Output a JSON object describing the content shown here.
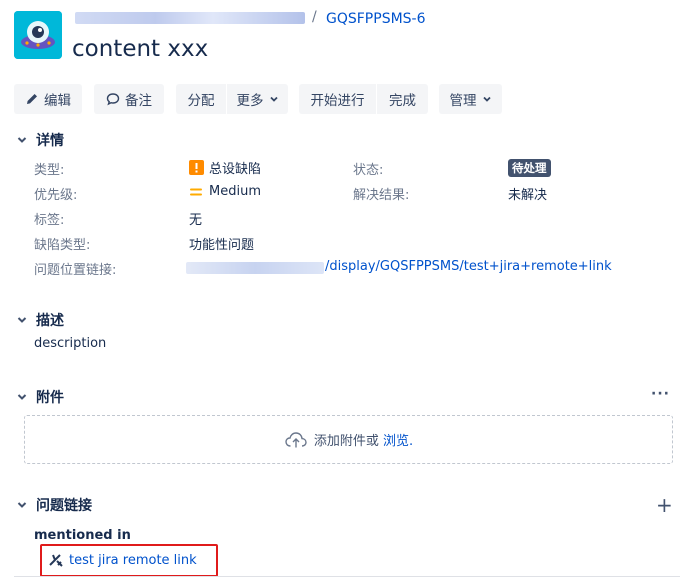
{
  "header": {
    "issue_key": "GQSFPPSMS-6",
    "separator": "/",
    "title": "content xxx"
  },
  "toolbar": {
    "edit_label": "编辑",
    "comment_label": "备注",
    "assign_label": "分配",
    "more_label": "更多",
    "start_label": "开始进行",
    "done_label": "完成",
    "admin_label": "管理"
  },
  "details": {
    "heading": "详情",
    "type_label": "类型:",
    "type_value": "总设缺陷",
    "status_label": "状态:",
    "status_value": "待处理",
    "priority_label": "优先级:",
    "priority_value": "Medium",
    "resolution_label": "解决结果:",
    "resolution_value": "未解决",
    "labels_label": "标签:",
    "labels_value": "无",
    "defect_type_label": "缺陷类型:",
    "defect_type_value": "功能性问题",
    "location_link_label": "问题位置链接:",
    "location_link_value": "/display/GQSFPPSMS/test+jira+remote+link"
  },
  "description": {
    "heading": "描述",
    "text": "description"
  },
  "attachments": {
    "heading": "附件",
    "more": "···",
    "drop_text": "添加附件或",
    "browse_link": "浏览."
  },
  "issue_links": {
    "heading": "问题链接",
    "add": "+",
    "relation": "mentioned in",
    "link_text": "test jira remote link"
  },
  "colors": {
    "link": "#0052cc",
    "button_bg": "#f4f5f7",
    "status_bg": "#42526e",
    "type_icon": "#ff8b00",
    "priority_icon": "#ffab00",
    "highlight_box": "#e01b1b",
    "avatar_bg": "#00b8d9"
  }
}
